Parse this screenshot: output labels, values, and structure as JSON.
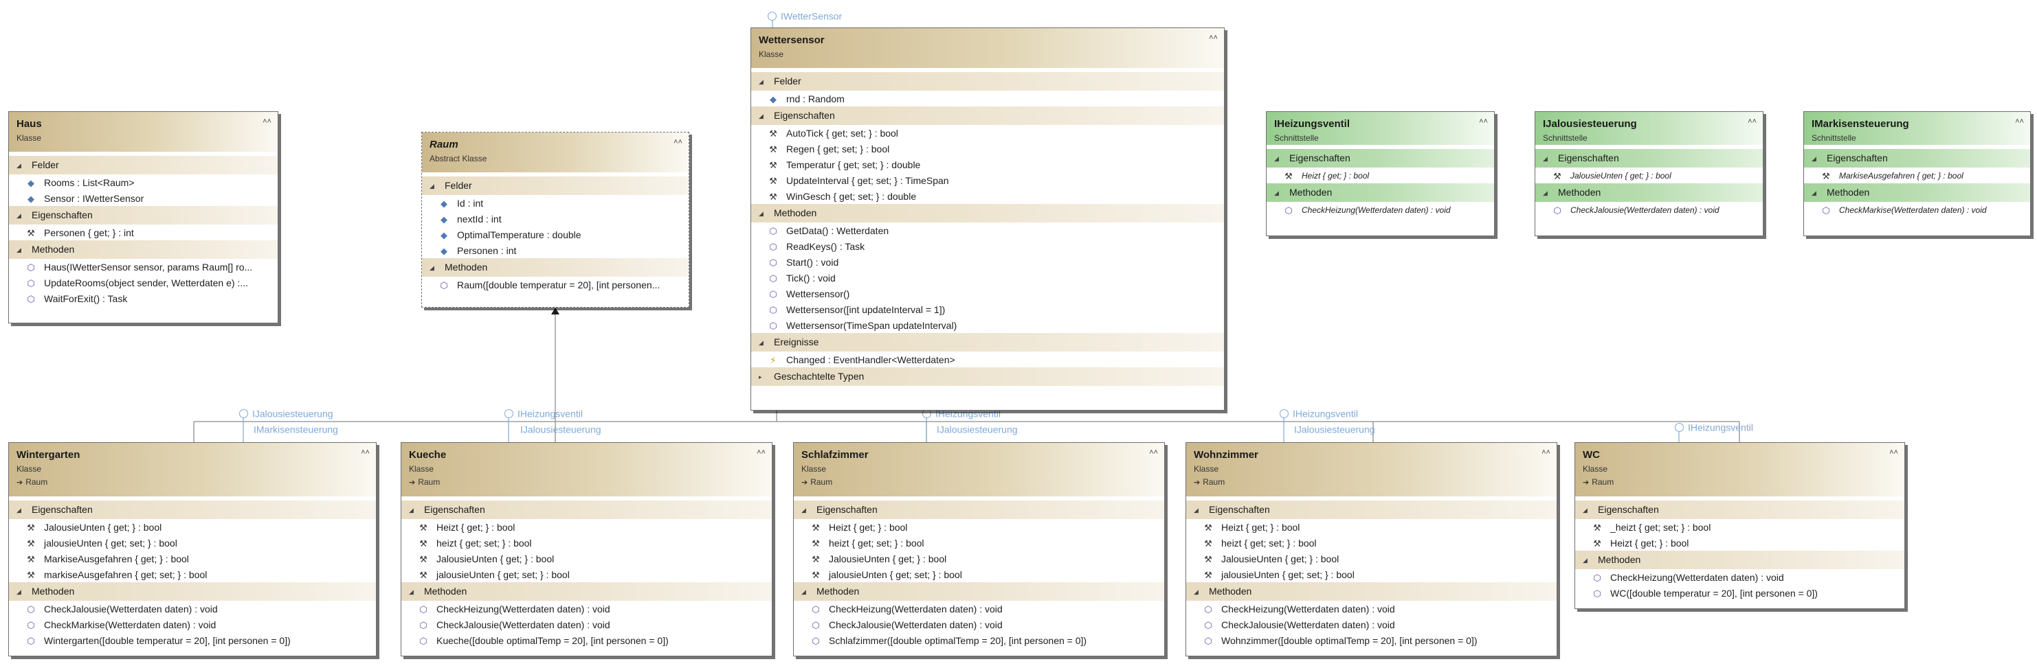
{
  "boxes": {
    "haus": {
      "name": "Haus",
      "kind": "Klasse",
      "sections": [
        {
          "label": "Felder",
          "members": [
            {
              "icon": "field-icon",
              "text": "Rooms : List<Raum>"
            },
            {
              "icon": "field-icon",
              "text": "Sensor : IWetterSensor"
            }
          ]
        },
        {
          "label": "Eigenschaften",
          "members": [
            {
              "icon": "property-icon",
              "text": "Personen { get; } : int"
            }
          ]
        },
        {
          "label": "Methoden",
          "members": [
            {
              "icon": "method-icon",
              "text": "Haus(IWetterSensor sensor, params Raum[] ro..."
            },
            {
              "icon": "method-icon",
              "text": "UpdateRooms(object sender, Wetterdaten e) :..."
            },
            {
              "icon": "method-icon",
              "text": "WaitForExit() : Task"
            }
          ]
        }
      ]
    },
    "raum": {
      "name": "Raum",
      "kind": "Abstract Klasse",
      "sections": [
        {
          "label": "Felder",
          "members": [
            {
              "icon": "field-icon",
              "text": "Id : int"
            },
            {
              "icon": "field-icon",
              "text": "nextId : int"
            },
            {
              "icon": "field-icon",
              "text": "OptimalTemperature : double"
            },
            {
              "icon": "field-icon",
              "text": "Personen : int"
            }
          ]
        },
        {
          "label": "Methoden",
          "members": [
            {
              "icon": "method-icon",
              "text": "Raum([double temperatur = 20], [int personen..."
            }
          ]
        }
      ]
    },
    "wettersensor": {
      "name": "Wettersensor",
      "kind": "Klasse",
      "sections": [
        {
          "label": "Felder",
          "members": [
            {
              "icon": "field-icon",
              "text": "rnd : Random"
            }
          ]
        },
        {
          "label": "Eigenschaften",
          "members": [
            {
              "icon": "property-icon",
              "text": "AutoTick { get; set; } : bool"
            },
            {
              "icon": "property-icon",
              "text": "Regen { get; set; } : bool"
            },
            {
              "icon": "property-icon",
              "text": "Temperatur { get; set; } : double"
            },
            {
              "icon": "property-icon",
              "text": "UpdateInterval { get; set; } : TimeSpan"
            },
            {
              "icon": "property-icon",
              "text": "WinGesch { get; set; } : double"
            }
          ]
        },
        {
          "label": "Methoden",
          "members": [
            {
              "icon": "method-icon",
              "text": "GetData() : Wetterdaten"
            },
            {
              "icon": "method-icon",
              "text": "ReadKeys() : Task"
            },
            {
              "icon": "method-icon",
              "text": "Start() : void"
            },
            {
              "icon": "method-icon",
              "text": "Tick() : void"
            },
            {
              "icon": "method-icon",
              "text": "Wettersensor()"
            },
            {
              "icon": "method-icon",
              "text": "Wettersensor([int updateInterval = 1])"
            },
            {
              "icon": "method-icon",
              "text": "Wettersensor(TimeSpan updateInterval)"
            }
          ]
        },
        {
          "label": "Ereignisse",
          "members": [
            {
              "icon": "event-icon",
              "text": "Changed : EventHandler<Wetterdaten>"
            }
          ]
        },
        {
          "label": "Geschachtelte Typen",
          "collapsed": true,
          "members": []
        }
      ]
    },
    "iheizungsventil": {
      "name": "IHeizungsventil",
      "kind": "Schnittstelle",
      "sections": [
        {
          "label": "Eigenschaften",
          "members": [
            {
              "icon": "property-icon",
              "text": "Heizt { get; } : bool"
            }
          ]
        },
        {
          "label": "Methoden",
          "members": [
            {
              "icon": "method-icon",
              "text": "CheckHeizung(Wetterdaten daten) : void"
            }
          ]
        }
      ]
    },
    "ijalousiesteuerung": {
      "name": "IJalousiesteuerung",
      "kind": "Schnittstelle",
      "sections": [
        {
          "label": "Eigenschaften",
          "members": [
            {
              "icon": "property-icon",
              "text": "JalousieUnten { get; } : bool"
            }
          ]
        },
        {
          "label": "Methoden",
          "members": [
            {
              "icon": "method-icon",
              "text": "CheckJalousie(Wetterdaten daten) : void"
            }
          ]
        }
      ]
    },
    "imarkisensteuerung": {
      "name": "IMarkisensteuerung",
      "kind": "Schnittstelle",
      "sections": [
        {
          "label": "Eigenschaften",
          "members": [
            {
              "icon": "property-icon",
              "text": "MarkiseAusgefahren { get; } : bool"
            }
          ]
        },
        {
          "label": "Methoden",
          "members": [
            {
              "icon": "method-icon",
              "text": "CheckMarkise(Wetterdaten daten) : void"
            }
          ]
        }
      ]
    },
    "wintergarten": {
      "name": "Wintergarten",
      "kind": "Klasse",
      "base": "Raum",
      "sections": [
        {
          "label": "Eigenschaften",
          "members": [
            {
              "icon": "property-icon",
              "text": "JalousieUnten { get; } : bool"
            },
            {
              "icon": "private-property-icon",
              "text": "jalousieUnten { get; set; } : bool"
            },
            {
              "icon": "property-icon",
              "text": "MarkiseAusgefahren { get; } : bool"
            },
            {
              "icon": "private-property-icon",
              "text": "markiseAusgefahren { get; set; } : bool"
            }
          ]
        },
        {
          "label": "Methoden",
          "members": [
            {
              "icon": "method-icon",
              "text": "CheckJalousie(Wetterdaten daten) : void"
            },
            {
              "icon": "method-icon",
              "text": "CheckMarkise(Wetterdaten daten) : void"
            },
            {
              "icon": "method-icon",
              "text": "Wintergarten([double temperatur = 20], [int personen = 0])"
            }
          ]
        }
      ]
    },
    "kueche": {
      "name": "Kueche",
      "kind": "Klasse",
      "base": "Raum",
      "sections": [
        {
          "label": "Eigenschaften",
          "members": [
            {
              "icon": "property-icon",
              "text": "Heizt { get; } : bool"
            },
            {
              "icon": "private-property-icon",
              "text": "heizt { get; set; } : bool"
            },
            {
              "icon": "property-icon",
              "text": "JalousieUnten { get; } : bool"
            },
            {
              "icon": "private-property-icon",
              "text": "jalousieUnten { get; set; } : bool"
            }
          ]
        },
        {
          "label": "Methoden",
          "members": [
            {
              "icon": "method-icon",
              "text": "CheckHeizung(Wetterdaten daten) : void"
            },
            {
              "icon": "method-icon",
              "text": "CheckJalousie(Wetterdaten daten) : void"
            },
            {
              "icon": "method-icon",
              "text": "Kueche([double optimalTemp = 20], [int personen = 0])"
            }
          ]
        }
      ]
    },
    "schlafzimmer": {
      "name": "Schlafzimmer",
      "kind": "Klasse",
      "base": "Raum",
      "sections": [
        {
          "label": "Eigenschaften",
          "members": [
            {
              "icon": "property-icon",
              "text": "Heizt { get; } : bool"
            },
            {
              "icon": "private-property-icon",
              "text": "heizt { get; set; } : bool"
            },
            {
              "icon": "property-icon",
              "text": "JalousieUnten { get; } : bool"
            },
            {
              "icon": "private-property-icon",
              "text": "jalousieUnten { get; set; } : bool"
            }
          ]
        },
        {
          "label": "Methoden",
          "members": [
            {
              "icon": "method-icon",
              "text": "CheckHeizung(Wetterdaten daten) : void"
            },
            {
              "icon": "method-icon",
              "text": "CheckJalousie(Wetterdaten daten) : void"
            },
            {
              "icon": "method-icon",
              "text": "Schlafzimmer([double optimalTemp = 20], [int personen = 0])"
            }
          ]
        }
      ]
    },
    "wohnzimmer": {
      "name": "Wohnzimmer",
      "kind": "Klasse",
      "base": "Raum",
      "sections": [
        {
          "label": "Eigenschaften",
          "members": [
            {
              "icon": "property-icon",
              "text": "Heizt { get; } : bool"
            },
            {
              "icon": "private-property-icon",
              "text": "heizt { get; set; } : bool"
            },
            {
              "icon": "property-icon",
              "text": "JalousieUnten { get; } : bool"
            },
            {
              "icon": "private-property-icon",
              "text": "jalousieUnten { get; set; } : bool"
            }
          ]
        },
        {
          "label": "Methoden",
          "members": [
            {
              "icon": "method-icon",
              "text": "CheckHeizung(Wetterdaten daten) : void"
            },
            {
              "icon": "method-icon",
              "text": "CheckJalousie(Wetterdaten daten) : void"
            },
            {
              "icon": "method-icon",
              "text": "Wohnzimmer([double optimalTemp = 20], [int personen = 0])"
            }
          ]
        }
      ]
    },
    "wc": {
      "name": "WC",
      "kind": "Klasse",
      "base": "Raum",
      "sections": [
        {
          "label": "Eigenschaften",
          "members": [
            {
              "icon": "private-property-icon",
              "text": "_heizt { get; set; } : bool"
            },
            {
              "icon": "property-icon",
              "text": "Heizt { get; } : bool"
            }
          ]
        },
        {
          "label": "Methoden",
          "members": [
            {
              "icon": "method-icon",
              "text": "CheckHeizung(Wetterdaten daten) : void"
            },
            {
              "icon": "method-icon",
              "text": "WC([double temperatur = 20], [int personen = 0])"
            }
          ]
        }
      ]
    }
  },
  "lollipops": {
    "iwettersensor": "IWetterSensor",
    "wg_jal": "IJalousiesteuerung",
    "wg_mark": "IMarkisensteuerung",
    "ku_heiz": "IHeizungsventil",
    "ku_jal": "IJalousiesteuerung",
    "sz_heiz": "IHeizungsventil",
    "sz_jal": "IJalousiesteuerung",
    "wz_heiz": "IHeizungsventil",
    "wz_jal": "IJalousiesteuerung",
    "wc_heiz": "IHeizungsventil"
  },
  "colors": {
    "class_header": "#ccb88c",
    "interface_header": "#96cd8e",
    "lollipop": "#7fa9d6",
    "connector": "#8c8c8c"
  }
}
